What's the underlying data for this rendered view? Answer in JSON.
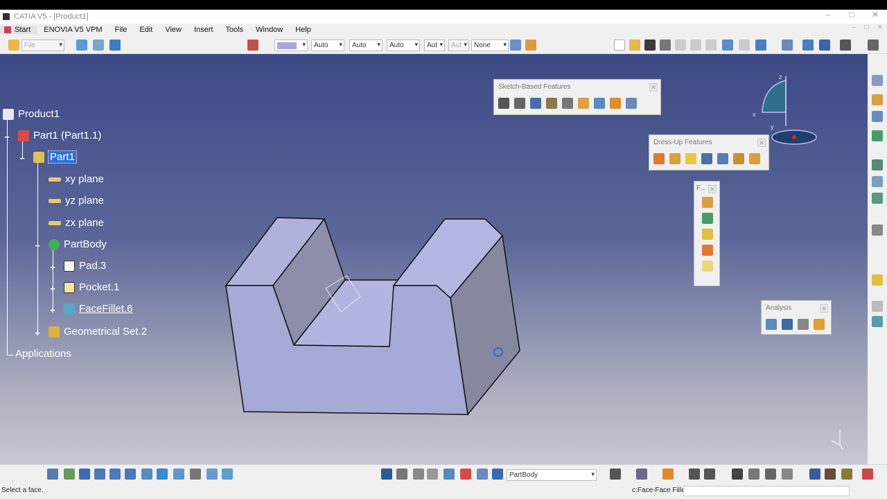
{
  "window": {
    "title": "CATIA V5 - [Product1]",
    "controls": [
      "–",
      "□",
      "✕"
    ]
  },
  "menu": {
    "items": [
      "Start",
      "ENOVIA V5 VPM",
      "File",
      "Edit",
      "View",
      "Insert",
      "Tools",
      "Window",
      "Help"
    ]
  },
  "toolbar": {
    "file_combo": "File",
    "fill_color": "#a8a8d8",
    "combo_1": "Auto",
    "combo_2": "Auto",
    "combo_3": "Auto",
    "combo_4": "Aut",
    "combo_5": "Aut",
    "combo_6": "None"
  },
  "tree": {
    "product": "Product1",
    "part_instance": "Part1 (Part1.1)",
    "part": "Part1",
    "planes": [
      "xy plane",
      "yz plane",
      "zx plane"
    ],
    "body": "PartBody",
    "features": [
      "Pad.3",
      "Pocket.1",
      "FaceFillet.6"
    ],
    "geo_set": "Geometrical Set.2",
    "applications": "Applications"
  },
  "panels": {
    "sketch_based": {
      "title": "Sketch-Based Features"
    },
    "dress_up": {
      "title": "Dress-Up Features"
    },
    "floating": {
      "title": "F..."
    },
    "analysis": {
      "title": "Analysis"
    }
  },
  "compass": {
    "x": "x",
    "y": "y",
    "z": "z"
  },
  "bottom": {
    "body_combo": "PartBody"
  },
  "status": {
    "message": "Select a face.",
    "command": "c:Face-Face Fillet"
  },
  "colors": {
    "viewport_top": "#3c4a86",
    "viewport_bottom": "#c9c9d4",
    "part_face": "#a8aad6",
    "selection": "#2f6fd6"
  }
}
